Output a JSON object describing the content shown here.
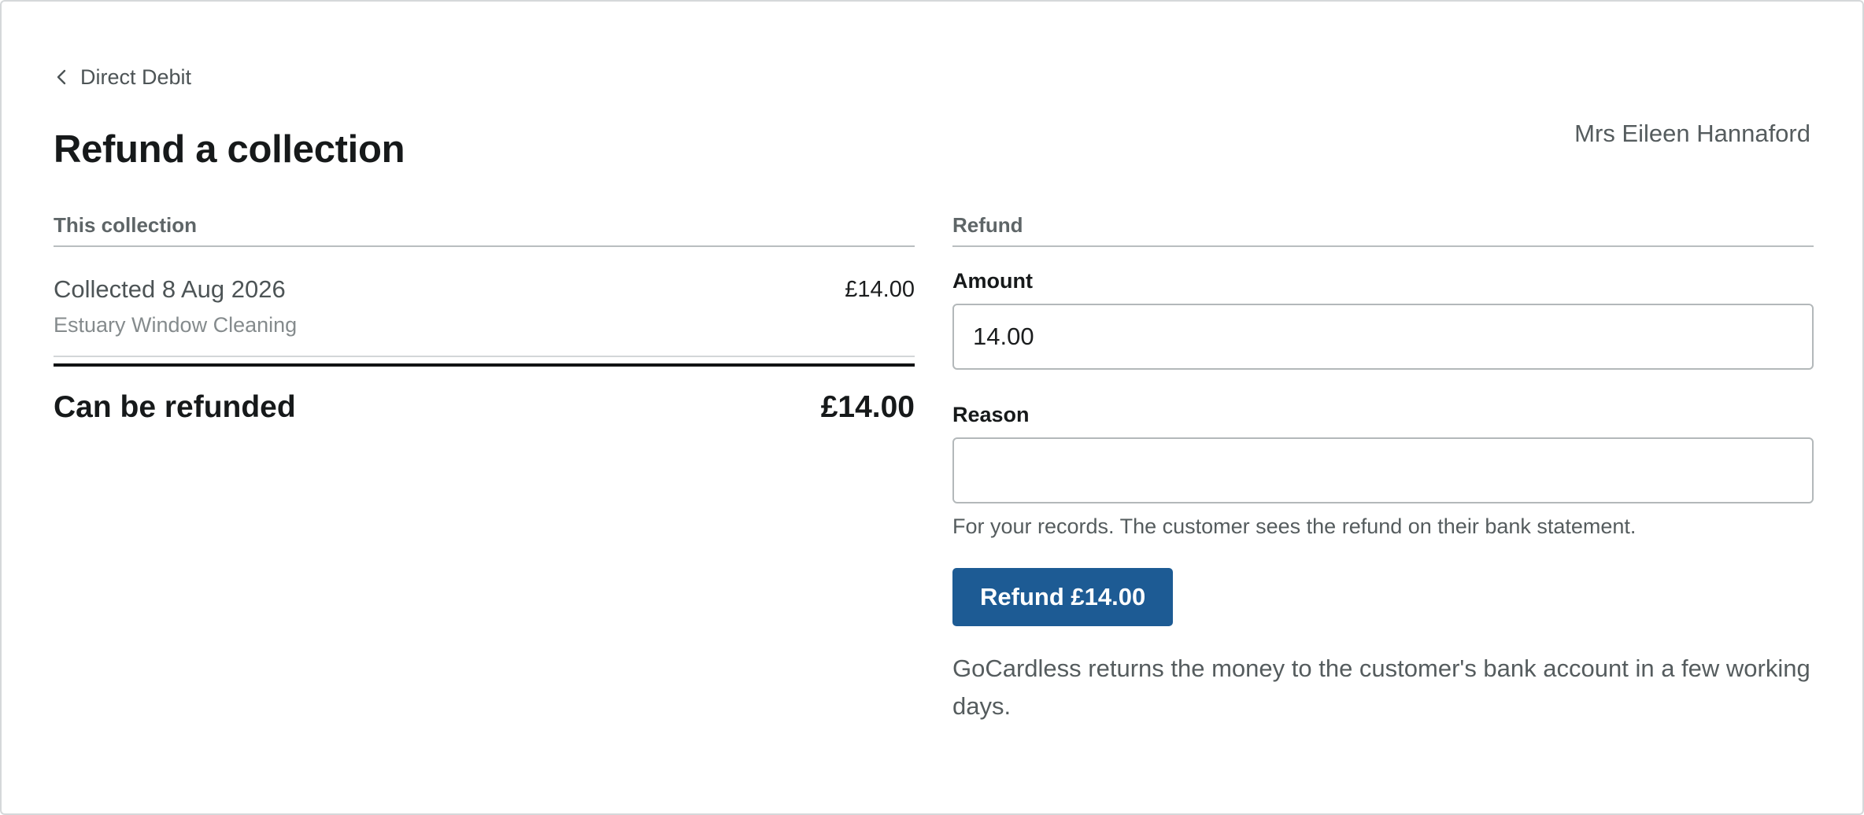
{
  "nav": {
    "back_label": "Direct Debit",
    "back_icon": "chevron-left-icon"
  },
  "header": {
    "title": "Refund a collection",
    "customer_name": "Mrs Eileen Hannaford"
  },
  "collection": {
    "heading": "This collection",
    "date_label": "Collected 8 Aug 2026",
    "payee": "Estuary Window Cleaning",
    "amount": "£14.00",
    "refundable_label": "Can be refunded",
    "refundable_amount": "£14.00"
  },
  "refund_form": {
    "heading": "Refund",
    "amount_label": "Amount",
    "amount_value": "14.00",
    "reason_label": "Reason",
    "reason_value": "",
    "reason_hint": "For your records. The customer sees the refund on their bank statement.",
    "submit_label": "Refund £14.00",
    "footnote": "GoCardless returns the money to the customer's bank account in a few working days."
  },
  "colors": {
    "primary": "#1d5b94",
    "text": "#16191a",
    "muted": "#555c5e",
    "border": "#b3b8ba"
  }
}
